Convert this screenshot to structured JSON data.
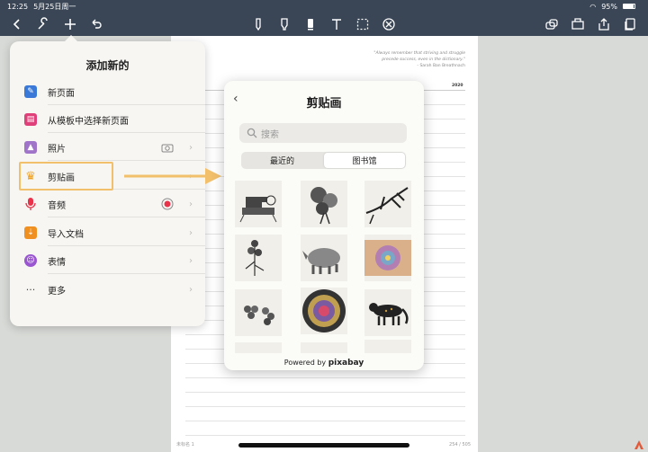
{
  "status": {
    "time": "12:25",
    "date": "5月25日周一",
    "battery": "95%"
  },
  "page": {
    "quote_line1": "\"Always remember that striving and struggle",
    "quote_line2": "precede success, even in the dictionary.\"",
    "quote_author": "- Sarah Ban Breathnach",
    "year": "2020",
    "footer_left": "未标名 1",
    "footer_right": "254 / 505"
  },
  "menu": {
    "title": "添加新的",
    "items": [
      {
        "label": "新页面",
        "icon": "new-page-icon",
        "color": "#3a79d8"
      },
      {
        "label": "从模板中选择新页面",
        "icon": "template-icon",
        "color": "#e0407a"
      },
      {
        "label": "照片",
        "icon": "photo-icon",
        "color": "#a074c8"
      },
      {
        "label": "剪贴画",
        "icon": "crown-icon",
        "color": "#f0a020"
      },
      {
        "label": "音频",
        "icon": "microphone-icon",
        "color": "#e8334a"
      },
      {
        "label": "导入文档",
        "icon": "import-icon",
        "color": "#f09020"
      },
      {
        "label": "表情",
        "icon": "emoji-icon",
        "color": "#9a55d0"
      },
      {
        "label": "更多",
        "icon": "more-icon",
        "color": "#555555"
      }
    ]
  },
  "clipart": {
    "title": "剪贴画",
    "search_placeholder": "搜索",
    "tabs": [
      "最近的",
      "图书馆"
    ],
    "selected_tab": "图书馆",
    "thumbnails": [
      "sewing-machine",
      "flower-bouquet",
      "tree-branch",
      "lilac-plant",
      "rhinoceros",
      "colorful-swirl",
      "grapes",
      "rose-window",
      "leopard",
      "mushroom",
      "ornament",
      "crown-plant"
    ],
    "powered_by": "Powered by",
    "brand": "pixabay"
  },
  "accent": "#f2c06b"
}
